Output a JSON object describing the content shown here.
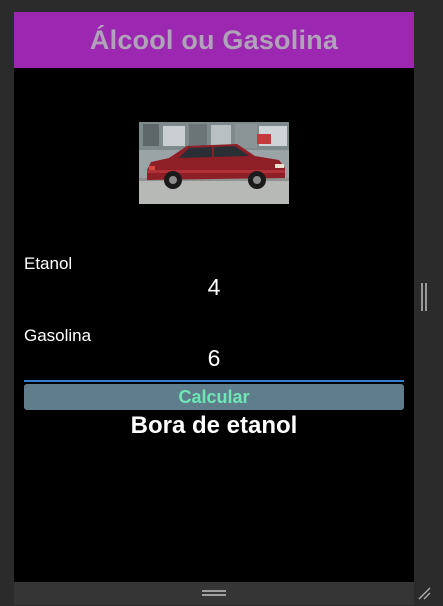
{
  "header": {
    "title": "Álcool ou Gasolina"
  },
  "form": {
    "etanol_label": "Etanol",
    "etanol_value": "4",
    "gasolina_label": "Gasolina",
    "gasolina_value": "6",
    "calcular_label": "Calcular"
  },
  "result": {
    "text": "Bora de etanol"
  },
  "colors": {
    "header_bg": "#9c27b0",
    "title_text": "#b0a2b8",
    "content_bg": "#000000",
    "button_bg": "#607d8b",
    "button_text": "#6ee7b7",
    "focus_underline": "#2f7fd1"
  },
  "icons": {
    "car_image": "red-sedan-photo",
    "side_handle": "vertical-grip-icon",
    "bottom_handle": "horizontal-grip-icon",
    "resize": "resize-grip-icon"
  }
}
